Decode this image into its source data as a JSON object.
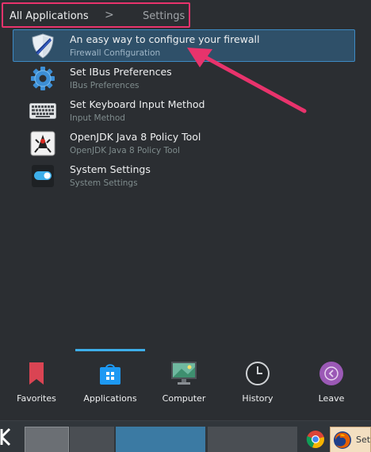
{
  "breadcrumb": {
    "root": "All Applications",
    "separator": ">",
    "current": "Settings"
  },
  "apps": [
    {
      "name": "An easy way to configure your firewall",
      "description": "Firewall Configuration",
      "icon": "firewall-shield-icon",
      "selected": true
    },
    {
      "name": "Set IBus Preferences",
      "description": "IBus Preferences",
      "icon": "gear-icon",
      "selected": false
    },
    {
      "name": "Set Keyboard Input Method",
      "description": "Input Method",
      "icon": "keyboard-icon",
      "selected": false
    },
    {
      "name": "OpenJDK Java 8 Policy Tool",
      "description": "OpenJDK Java 8 Policy Tool",
      "icon": "java-duke-icon",
      "selected": false
    },
    {
      "name": "System Settings",
      "description": "System Settings",
      "icon": "toggle-switch-icon",
      "selected": false
    }
  ],
  "tabs": [
    {
      "label": "Favorites",
      "icon": "bookmark-icon",
      "active": false
    },
    {
      "label": "Applications",
      "icon": "applications-bag-icon",
      "active": true
    },
    {
      "label": "Computer",
      "icon": "monitor-icon",
      "active": false
    },
    {
      "label": "History",
      "icon": "clock-icon",
      "active": false
    },
    {
      "label": "Leave",
      "icon": "leave-icon",
      "active": false
    }
  ],
  "taskbar": {
    "firefox_label": "Set"
  },
  "colors": {
    "annotation": "#e8336c",
    "selection": "#3d8ac4",
    "accent": "#3daee9"
  }
}
